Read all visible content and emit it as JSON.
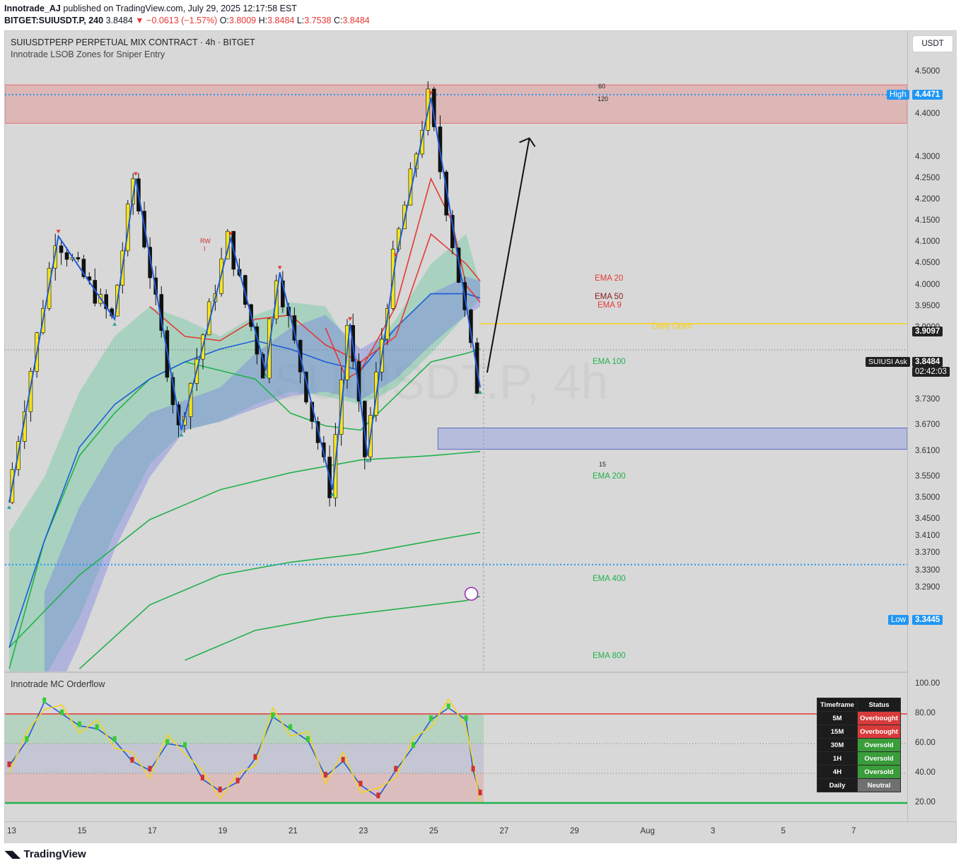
{
  "header": {
    "publisher": "Innotrade_AJ",
    "published_text": "published on TradingView.com, July 29, 2025 12:17:58 EST",
    "symbol_line": "BITGET:SUIUSDT.P, 240",
    "last": "3.8484",
    "change": "▼ −0.0613 (−1.57%)",
    "o_label": "O:",
    "o": "3.8009",
    "h_label": "H:",
    "h": "3.8484",
    "l_label": "L:",
    "l": "3.7538",
    "c_label": "C:",
    "c": "3.8484"
  },
  "chart": {
    "title": "SUIUSDTPERP PERPETUAL MIX CONTRACT · 4h · BITGET",
    "indicator": "Innotrade LSOB Zones for Sniper Entry",
    "watermark": "SUIUSDT.P, 4h",
    "currency_button": "USDT",
    "price_ticks": [
      "4.5000",
      "4.4000",
      "4.3000",
      "4.2500",
      "4.2000",
      "4.1500",
      "4.1000",
      "4.0500",
      "4.0000",
      "3.9500",
      "3.9000",
      "3.7900",
      "3.7300",
      "3.6700",
      "3.6100",
      "3.5500",
      "3.5000",
      "3.4500",
      "3.4100",
      "3.3700",
      "3.3300",
      "3.2900"
    ],
    "high_label": "High",
    "high_value": "4.4471",
    "low_label": "Low",
    "low_value": "3.3445",
    "daily_open_label": "Daily Open",
    "daily_open_value": "3.9097",
    "ask_label": "SUIUSI Ask",
    "ask_value": "3.8484",
    "countdown": "02:42:03",
    "ema_labels": [
      "EMA 20",
      "EMA 50",
      "EMA 9",
      "EMA 100",
      "EMA 200",
      "EMA 400",
      "EMA 800"
    ],
    "zone_numbers": [
      "60",
      "120",
      "15"
    ],
    "rw_label": "RW",
    "rw_sub": "I",
    "time_ticks": [
      "13",
      "15",
      "17",
      "19",
      "21",
      "23",
      "25",
      "27",
      "29",
      "Aug",
      "3",
      "5",
      "7"
    ]
  },
  "oscillator": {
    "title": "Innotrade MC Orderflow",
    "ticks": [
      "100.00",
      "80.00",
      "60.00",
      "40.00",
      "20.00"
    ],
    "table_header": [
      "Timeframe",
      "Status"
    ],
    "table_rows": [
      {
        "tf": "5M",
        "status": "Overbought"
      },
      {
        "tf": "15M",
        "status": "Overbought"
      },
      {
        "tf": "30M",
        "status": "Oversold"
      },
      {
        "tf": "1H",
        "status": "Oversold"
      },
      {
        "tf": "4H",
        "status": "Oversold"
      },
      {
        "tf": "Daily",
        "status": "Neutral"
      }
    ]
  },
  "chart_data": {
    "type": "candlestick",
    "title": "SUIUSDTPERP PERPETUAL MIX CONTRACT · 4h · BITGET",
    "x": [
      "13",
      "15",
      "17",
      "19",
      "21",
      "23",
      "25",
      "27",
      "29"
    ],
    "price_range": [
      3.27,
      4.53
    ],
    "levels": {
      "high": 4.4471,
      "low": 3.3445,
      "daily_open": 3.9097,
      "last": 3.8484
    },
    "supply_zone": [
      4.38,
      4.47
    ],
    "demand_zone": [
      3.615,
      3.665
    ],
    "swing_points": [
      {
        "t": 13.0,
        "p": 3.49
      },
      {
        "t": 14.4,
        "p": 4.115
      },
      {
        "t": 16.0,
        "p": 3.92
      },
      {
        "t": 16.6,
        "p": 4.25
      },
      {
        "t": 17.9,
        "p": 3.66
      },
      {
        "t": 19.3,
        "p": 4.11
      },
      {
        "t": 20.3,
        "p": 3.8
      },
      {
        "t": 20.7,
        "p": 4.03
      },
      {
        "t": 22.2,
        "p": 3.52
      },
      {
        "t": 22.7,
        "p": 3.91
      },
      {
        "t": 23.2,
        "p": 3.6
      },
      {
        "t": 24.0,
        "p": 4.06
      },
      {
        "t": 25.0,
        "p": 4.44
      },
      {
        "t": 26.4,
        "p": 3.76
      }
    ],
    "ema_800_last": 3.27,
    "ema_400_last": 3.42,
    "ema_200_last": 3.61,
    "ema_100_last": 3.85,
    "ema_50_last": 3.98,
    "ema_20_last": 4.01,
    "ema_9_last": 3.96
  }
}
